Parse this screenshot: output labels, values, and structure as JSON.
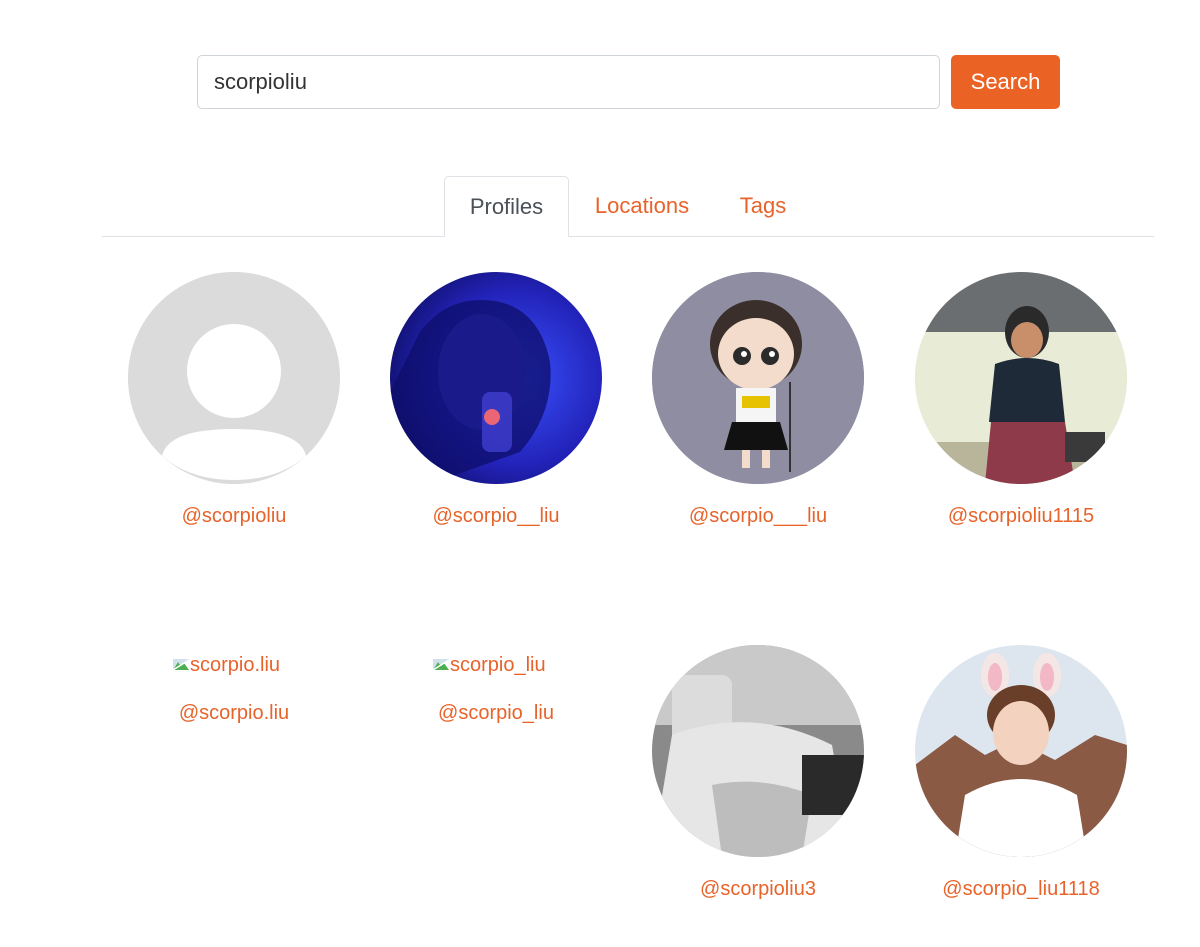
{
  "search": {
    "value": "scorpioliu",
    "button_label": "Search"
  },
  "tabs": [
    {
      "label": "Profiles",
      "active": true
    },
    {
      "label": "Locations",
      "active": false
    },
    {
      "label": "Tags",
      "active": false
    }
  ],
  "profiles": [
    {
      "handle": "@scorpioliu",
      "avatar": "default-avatar"
    },
    {
      "handle": "@scorpio__liu",
      "avatar": "photo-blue"
    },
    {
      "handle": "@scorpio___liu",
      "avatar": "cartoon-girl"
    },
    {
      "handle": "@scorpioliu1115",
      "avatar": "photo-man"
    },
    {
      "handle": "@scorpio.liu",
      "avatar": "broken-image",
      "alt": "scorpio.liu"
    },
    {
      "handle": "@scorpio_liu",
      "avatar": "broken-image",
      "alt": "scorpio_liu"
    },
    {
      "handle": "@scorpioliu3",
      "avatar": "photo-bw"
    },
    {
      "handle": "@scorpio_liu1118",
      "avatar": "photo-bunny"
    }
  ],
  "colors": {
    "accent": "#ea6324",
    "link": "#e8632a",
    "tab_active_text": "#495057"
  }
}
